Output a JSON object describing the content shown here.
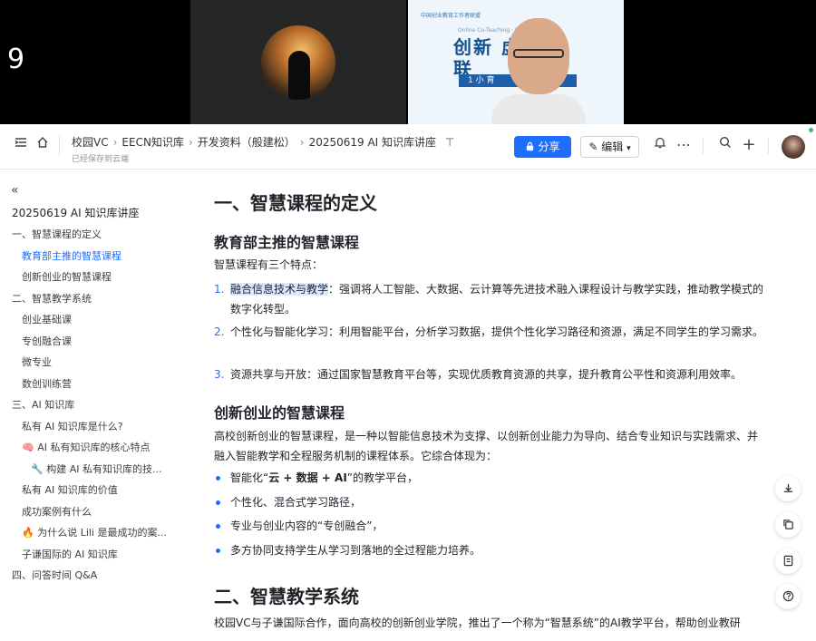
{
  "video": {
    "participant_count": "9",
    "slide_small_text": "中国创业教育工作者联盟",
    "slide_sub_text": "Online Co-Teaching · Education",
    "slide_title_1": "创新  虚拟",
    "slide_title_2": "联",
    "slide_banner": "1 小         育"
  },
  "header": {
    "breadcrumbs": [
      "校园VC",
      "EECN知识库",
      "开发资料（般建松）",
      "20250619 AI 知识库讲座"
    ],
    "pin_icon": "pin-icon",
    "saved_status": "已经保存到云端",
    "share_label": "分享",
    "edit_label": "编辑"
  },
  "sidebar": {
    "doc_title": "20250619 AI 知识库讲座",
    "items": [
      {
        "label": "一、智慧课程的定义",
        "level": 1,
        "active": false
      },
      {
        "label": "教育部主推的智慧课程",
        "level": 2,
        "active": true
      },
      {
        "label": "创新创业的智慧课程",
        "level": 2,
        "active": false
      },
      {
        "label": "二、智慧教学系统",
        "level": 1,
        "active": false
      },
      {
        "label": "创业基础课",
        "level": 2,
        "active": false
      },
      {
        "label": "专创融合课",
        "level": 2,
        "active": false
      },
      {
        "label": "微专业",
        "level": 2,
        "active": false
      },
      {
        "label": "数创训练营",
        "level": 2,
        "active": false
      },
      {
        "label": "三、AI 知识库",
        "level": 1,
        "active": false
      },
      {
        "label": "私有 AI 知识库是什么?",
        "level": 2,
        "active": false
      },
      {
        "label": "🧠 AI 私有知识库的核心特点",
        "level": 2,
        "active": false
      },
      {
        "label": "🔧 构建 AI 私有知识库的技...",
        "level": 3,
        "active": false
      },
      {
        "label": "私有 AI 知识库的价值",
        "level": 2,
        "active": false
      },
      {
        "label": "成功案例有什么",
        "level": 2,
        "active": false
      },
      {
        "label": "🔥 为什么说 Lili 是最成功的案...",
        "level": 2,
        "active": false
      },
      {
        "label": "子谦国际的 AI 知识库",
        "level": 2,
        "active": false
      },
      {
        "label": "四、问答时间 Q&A",
        "level": 1,
        "active": false
      }
    ]
  },
  "content": {
    "h1_a": "一、智慧课程的定义",
    "h2_a": "教育部主推的智慧课程",
    "intro_a": "智慧课程有三个特点：",
    "list_a": [
      {
        "num": "1.",
        "highlight": "融合信息技术与教学",
        "rest": "：强调将人工智能、大数据、云计算等先进技术融入课程设计与教学实践，推动教学模式的数字化转型。"
      },
      {
        "num": "2.",
        "highlight": "",
        "rest": "个性化与智能化学习：利用智能平台，分析学习数据，提供个性化学习路径和资源，满足不同学生的学习需求。"
      },
      {
        "num": "3.",
        "highlight": "",
        "rest": "资源共享与开放：通过国家智慧教育平台等，实现优质教育资源的共享，提升教育公平性和资源利用效率。"
      }
    ],
    "h2_b": "创新创业的智慧课程",
    "intro_b": "高校创新创业的智慧课程，是一种以智能信息技术为支撑、以创新创业能力为导向、结合专业知识与实践需求、并融入智能教学和全程服务机制的课程体系。它综合体现为：",
    "list_b_1_pre": "智能化“",
    "list_b_1_bold": "云 + 数据 + AI",
    "list_b_1_post": "”的教学平台，",
    "list_b_2": "个性化、混合式学习路径，",
    "list_b_3": "专业与创业内容的“专创融合”，",
    "list_b_4": "多方协同支持学生从学习到落地的全过程能力培养。",
    "h1_b": "二、智慧教学系统",
    "para_c": "校园VC与子谦国际合作，面向高校的创新创业学院，推出了一个称为“智慧系统”的AI教学平台，帮助创业教研"
  },
  "float_tools": [
    "download-icon",
    "copy-icon",
    "template-icon",
    "help-icon"
  ]
}
